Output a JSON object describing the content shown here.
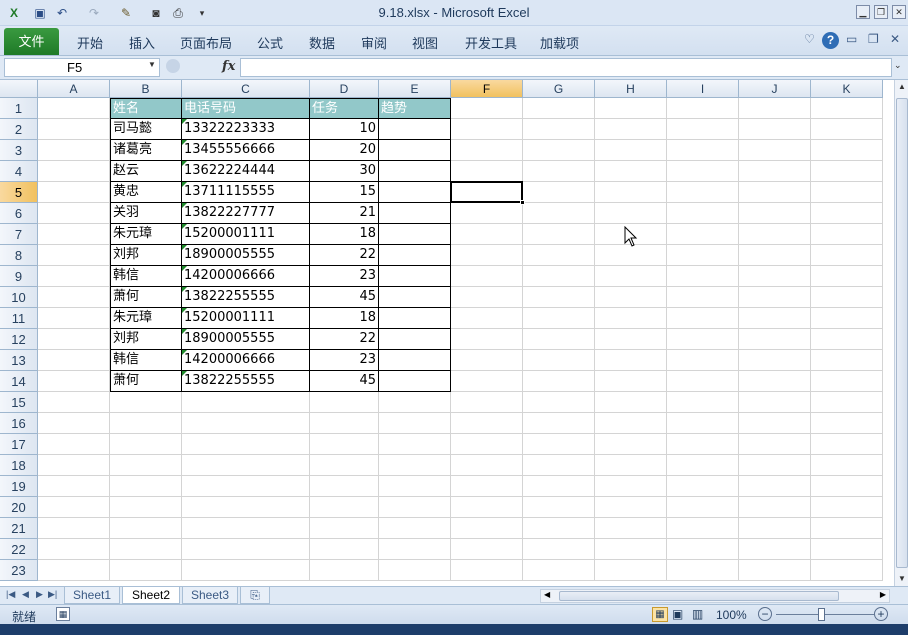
{
  "window": {
    "title": "9.18.xlsx  -  Microsoft Excel"
  },
  "ribbon": {
    "file_tab": "文件",
    "tabs": [
      "开始",
      "插入",
      "页面布局",
      "公式",
      "数据",
      "审阅",
      "视图",
      "开发工具",
      "加载项"
    ]
  },
  "formula_bar": {
    "name_box": "F5",
    "fx_label": "fx",
    "formula": ""
  },
  "columns": [
    "A",
    "B",
    "C",
    "D",
    "E",
    "F",
    "G",
    "H",
    "I",
    "J",
    "K"
  ],
  "selected_column": "F",
  "selected_row": 5,
  "rows": [
    "1",
    "2",
    "3",
    "4",
    "5",
    "6",
    "7",
    "8",
    "9",
    "10",
    "11",
    "12",
    "13",
    "14",
    "15",
    "16",
    "17",
    "18",
    "19",
    "20",
    "21",
    "22",
    "23"
  ],
  "table": {
    "headers": [
      "姓名",
      "电话号码",
      "任务",
      "趋势"
    ],
    "records": [
      {
        "name": "司马懿",
        "phone": "13322223333",
        "task": "10"
      },
      {
        "name": "诸葛亮",
        "phone": "13455556666",
        "task": "20"
      },
      {
        "name": "赵云",
        "phone": "13622224444",
        "task": "30"
      },
      {
        "name": "黄忠",
        "phone": "13711115555",
        "task": "15"
      },
      {
        "name": "关羽",
        "phone": "13822227777",
        "task": "21"
      },
      {
        "name": "朱元璋",
        "phone": "15200001111",
        "task": "18"
      },
      {
        "name": "刘邦",
        "phone": "18900005555",
        "task": "22"
      },
      {
        "name": "韩信",
        "phone": "14200006666",
        "task": "23"
      },
      {
        "name": "萧何",
        "phone": "13822255555",
        "task": "45"
      },
      {
        "name": "朱元璋",
        "phone": "15200001111",
        "task": "18"
      },
      {
        "name": "刘邦",
        "phone": "18900005555",
        "task": "22"
      },
      {
        "name": "韩信",
        "phone": "14200006666",
        "task": "23"
      },
      {
        "name": "萧何",
        "phone": "13822255555",
        "task": "45"
      }
    ]
  },
  "sheets": [
    "Sheet1",
    "Sheet2",
    "Sheet3"
  ],
  "active_sheet": "Sheet2",
  "status": {
    "ready": "就绪",
    "zoom": "100%"
  },
  "colors": {
    "header_fill": "#92c8c9",
    "file_tab": "#2a8a33",
    "selection_highlight": "#f1c15f"
  }
}
